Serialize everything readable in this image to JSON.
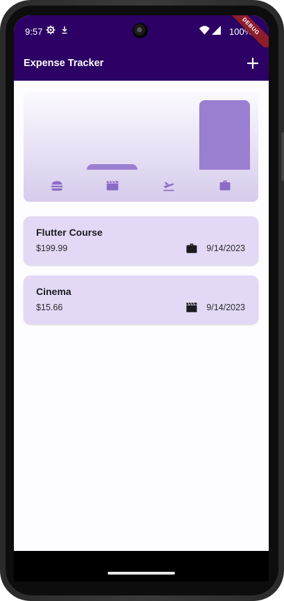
{
  "status_bar": {
    "time": "9:57",
    "battery": "100%"
  },
  "debug_banner": "DEBUG",
  "app_bar": {
    "title": "Expense Tracker",
    "add_icon": "plus-icon"
  },
  "colors": {
    "primary": "#2c0064",
    "bar": "#9a7fd1",
    "item_bg": "#e3d9f6"
  },
  "chart_data": {
    "type": "bar",
    "categories": [
      "food",
      "leisure",
      "travel",
      "work"
    ],
    "category_icons": [
      "burger-icon",
      "clapperboard-icon",
      "plane-icon",
      "briefcase-icon"
    ],
    "values": [
      0,
      15.66,
      0,
      199.99
    ],
    "ylim": [
      0,
      199.99
    ],
    "grid": false
  },
  "expenses": [
    {
      "title": "Flutter Course",
      "amount": "$199.99",
      "category_icon": "briefcase-icon",
      "date": "9/14/2023"
    },
    {
      "title": "Cinema",
      "amount": "$15.66",
      "category_icon": "clapperboard-icon",
      "date": "9/14/2023"
    }
  ]
}
